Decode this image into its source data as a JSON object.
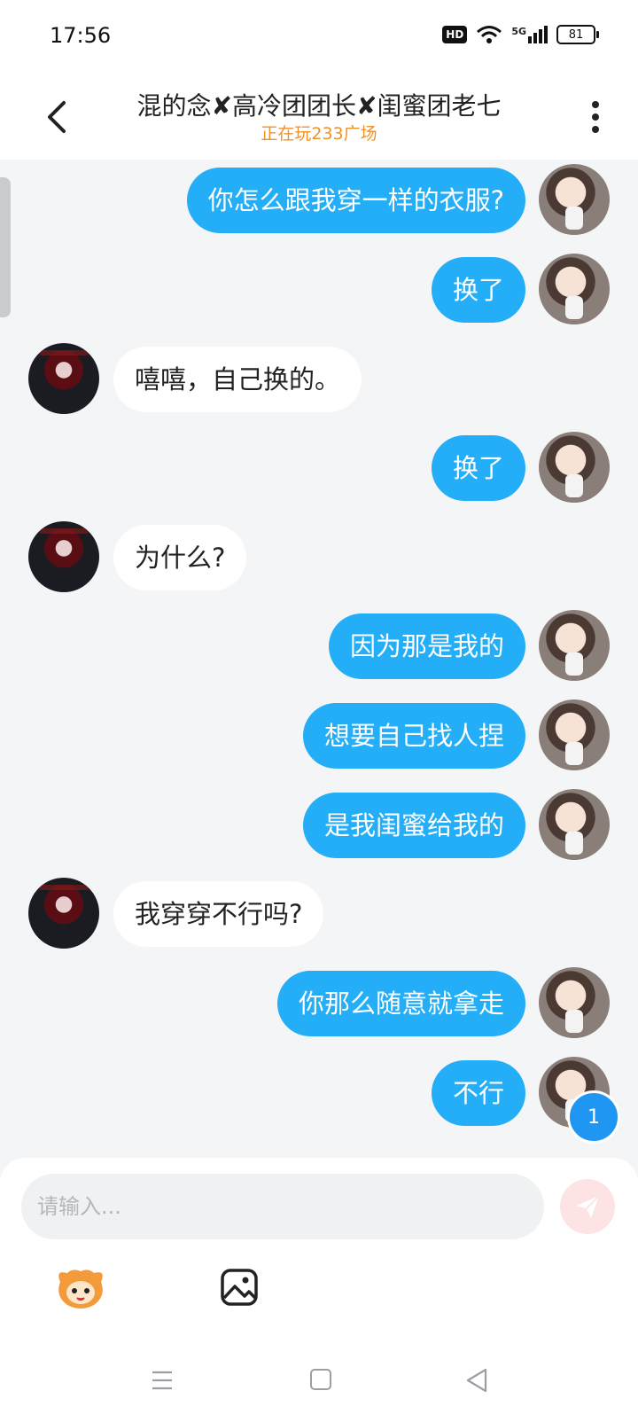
{
  "status_bar": {
    "time": "17:56",
    "hd_label": "HD",
    "network_label": "5G",
    "battery": "81"
  },
  "header": {
    "title": "混的念✘高冷团团长✘闺蜜团老七",
    "subtitle": "正在玩233广场",
    "back_icon": "chevron-left-icon",
    "more_icon": "more-vertical-icon"
  },
  "messages": [
    {
      "side": "out",
      "text": "你怎么跟我穿一样的衣服?"
    },
    {
      "side": "out",
      "text": "换了"
    },
    {
      "side": "in",
      "text": "嘻嘻，自己换的。"
    },
    {
      "side": "out",
      "text": "换了"
    },
    {
      "side": "in",
      "text": "为什么?"
    },
    {
      "side": "out",
      "text": "因为那是我的"
    },
    {
      "side": "out",
      "text": "想要自己找人捏"
    },
    {
      "side": "out",
      "text": "是我闺蜜给我的"
    },
    {
      "side": "in",
      "text": "我穿穿不行吗?"
    },
    {
      "side": "out",
      "text": "你那么随意就拿走"
    },
    {
      "side": "out",
      "text": "不行"
    }
  ],
  "unread_badge": "1",
  "composer": {
    "placeholder": "请输入...",
    "value": "",
    "send_icon": "paper-plane-icon",
    "tools": [
      "mascot-emoji-icon",
      "image-icon"
    ]
  },
  "colors": {
    "outgoing_bubble": "#23aef7",
    "incoming_bubble": "#ffffff",
    "subtitle": "#f0922a",
    "badge": "#1e96f2",
    "send_button_bg": "#fde3e3"
  },
  "system_nav": [
    "menu-icon",
    "home-icon",
    "back-triangle-icon"
  ]
}
